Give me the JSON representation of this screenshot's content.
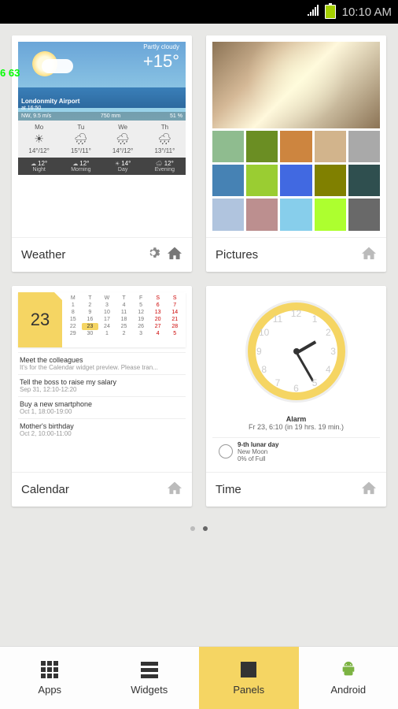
{
  "status": {
    "time": "10:10 AM"
  },
  "debug": "6  63",
  "weather": {
    "title": "Weather",
    "condition": "Partly cloudy",
    "temp": "+15°",
    "location": "Londonmity Airport",
    "location_time": "at 16:50",
    "wind": "NW, 9.5 m/s",
    "pressure": "750 mm",
    "humidity": "51 %",
    "forecast": [
      {
        "day": "Mo",
        "temp": "14°/12°",
        "icn": "☀"
      },
      {
        "day": "Tu",
        "temp": "15°/11°",
        "icn": "🌧"
      },
      {
        "day": "We",
        "temp": "14°/12°",
        "icn": "🌧"
      },
      {
        "day": "Th",
        "temp": "13°/11°",
        "icn": "🌧"
      }
    ],
    "timeofday": [
      {
        "label": "Night",
        "t": "12°",
        "icn": "☁"
      },
      {
        "label": "Morning",
        "t": "12°",
        "icn": "☁"
      },
      {
        "label": "Day",
        "t": "14°",
        "icn": "☀"
      },
      {
        "label": "Evening",
        "t": "12°",
        "icn": "🌧"
      }
    ]
  },
  "pictures": {
    "title": "Pictures",
    "thumbs": [
      "#8fbc8f",
      "#6b8e23",
      "#cd853f",
      "#d2b48c",
      "#a9a9a9",
      "#4682b4",
      "#9acd32",
      "#4169e1",
      "#808000",
      "#2f4f4f",
      "#b0c4de",
      "#bc8f8f",
      "#87ceeb",
      "#adff2f",
      "#696969"
    ]
  },
  "calendar": {
    "title": "Calendar",
    "today": "23",
    "header": [
      "M",
      "T",
      "W",
      "T",
      "F",
      "S",
      "S"
    ],
    "weeks": [
      [
        "1",
        "2",
        "3",
        "4",
        "5",
        "6",
        "7"
      ],
      [
        "8",
        "9",
        "10",
        "11",
        "12",
        "13",
        "14"
      ],
      [
        "15",
        "16",
        "17",
        "18",
        "19",
        "20",
        "21"
      ],
      [
        "22",
        "23",
        "24",
        "25",
        "26",
        "27",
        "28"
      ],
      [
        "29",
        "30",
        "1",
        "2",
        "3",
        "4",
        "5"
      ]
    ],
    "events": [
      {
        "title": "Meet the colleagues",
        "sub": "It's for the Calendar widget preview. Please tran..."
      },
      {
        "title": "Tell the boss to raise my salary",
        "sub": "Sep 31, 12:10-12:20"
      },
      {
        "title": "Buy a new smartphone",
        "sub": "Oct 1, 18:00-19:00"
      },
      {
        "title": "Mother's birthday",
        "sub": "Oct 2, 10:00-11:00"
      }
    ]
  },
  "time": {
    "title": "Time",
    "numbers": [
      "12",
      "1",
      "2",
      "3",
      "4",
      "5",
      "6",
      "7",
      "8",
      "9",
      "10",
      "11"
    ],
    "alarm_label": "Alarm",
    "alarm_time": "Fr 23, 6:10 (in 19 hrs. 19 min.)",
    "lunar_title": "9-th lunar day",
    "lunar_phase": "New Moon",
    "lunar_pct": "0% of Full"
  },
  "tabs": {
    "apps": "Apps",
    "widgets": "Widgets",
    "panels": "Panels",
    "android": "Android"
  }
}
